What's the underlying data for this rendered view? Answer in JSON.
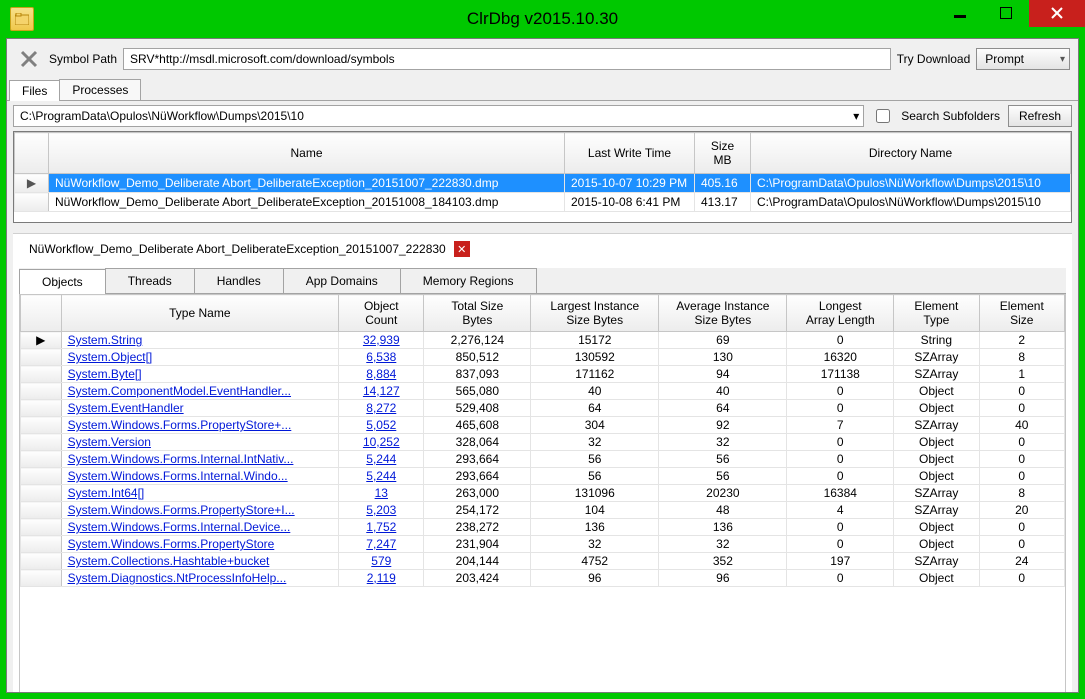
{
  "window": {
    "title": "ClrDbg v2015.10.30"
  },
  "symbol": {
    "label": "Symbol Path",
    "value": "SRV*http://msdl.microsoft.com/download/symbols",
    "try_download": "Try Download",
    "combo_value": "Prompt"
  },
  "main_tabs": [
    "Files",
    "Processes"
  ],
  "path": {
    "value": "C:\\ProgramData\\Opulos\\NüWorkflow\\Dumps\\2015\\10",
    "search_subfolders_label": "Search Subfolders",
    "refresh_label": "Refresh"
  },
  "file_grid": {
    "headers": [
      "Name",
      "Last Write Time",
      "Size MB",
      "Directory Name"
    ],
    "rows": [
      {
        "name": "NüWorkflow_Demo_Deliberate Abort_DeliberateException_20151007_222830.dmp",
        "lwt": "2015-10-07 10:29 PM",
        "size": "405.16",
        "dir": "C:\\ProgramData\\Opulos\\NüWorkflow\\Dumps\\2015\\10",
        "selected": true
      },
      {
        "name": "NüWorkflow_Demo_Deliberate Abort_DeliberateException_20151008_184103.dmp",
        "lwt": "2015-10-08 6:41 PM",
        "size": "413.17",
        "dir": "C:\\ProgramData\\Opulos\\NüWorkflow\\Dumps\\2015\\10",
        "selected": false
      }
    ]
  },
  "detail": {
    "tab_title": "NüWorkflow_Demo_Deliberate Abort_DeliberateException_20151007_222830",
    "sub_tabs": [
      "Objects",
      "Threads",
      "Handles",
      "App Domains",
      "Memory Regions"
    ]
  },
  "obj_grid": {
    "headers": [
      "Type Name",
      "Object Count",
      "Total Size Bytes",
      "Largest Instance Size Bytes",
      "Average Instance Size Bytes",
      "Longest Array Length",
      "Element Type",
      "Element Size"
    ],
    "rows": [
      {
        "type": "System.String",
        "count": "32,939",
        "total": "2,276,124",
        "largest": "15172",
        "avg": "69",
        "longest": "0",
        "etype": "String",
        "esize": "2",
        "current": true
      },
      {
        "type": "System.Object[]",
        "count": "6,538",
        "total": "850,512",
        "largest": "130592",
        "avg": "130",
        "longest": "16320",
        "etype": "SZArray",
        "esize": "8"
      },
      {
        "type": "System.Byte[]",
        "count": "8,884",
        "total": "837,093",
        "largest": "171162",
        "avg": "94",
        "longest": "171138",
        "etype": "SZArray",
        "esize": "1"
      },
      {
        "type": "System.ComponentModel.EventHandler...",
        "count": "14,127",
        "total": "565,080",
        "largest": "40",
        "avg": "40",
        "longest": "0",
        "etype": "Object",
        "esize": "0"
      },
      {
        "type": "System.EventHandler",
        "count": "8,272",
        "total": "529,408",
        "largest": "64",
        "avg": "64",
        "longest": "0",
        "etype": "Object",
        "esize": "0"
      },
      {
        "type": "System.Windows.Forms.PropertyStore+...",
        "count": "5,052",
        "total": "465,608",
        "largest": "304",
        "avg": "92",
        "longest": "7",
        "etype": "SZArray",
        "esize": "40"
      },
      {
        "type": "System.Version",
        "count": "10,252",
        "total": "328,064",
        "largest": "32",
        "avg": "32",
        "longest": "0",
        "etype": "Object",
        "esize": "0"
      },
      {
        "type": "System.Windows.Forms.Internal.IntNativ...",
        "count": "5,244",
        "total": "293,664",
        "largest": "56",
        "avg": "56",
        "longest": "0",
        "etype": "Object",
        "esize": "0"
      },
      {
        "type": "System.Windows.Forms.Internal.Windo...",
        "count": "5,244",
        "total": "293,664",
        "largest": "56",
        "avg": "56",
        "longest": "0",
        "etype": "Object",
        "esize": "0"
      },
      {
        "type": "System.Int64[]",
        "count": "13",
        "total": "263,000",
        "largest": "131096",
        "avg": "20230",
        "longest": "16384",
        "etype": "SZArray",
        "esize": "8"
      },
      {
        "type": "System.Windows.Forms.PropertyStore+I...",
        "count": "5,203",
        "total": "254,172",
        "largest": "104",
        "avg": "48",
        "longest": "4",
        "etype": "SZArray",
        "esize": "20"
      },
      {
        "type": "System.Windows.Forms.Internal.Device...",
        "count": "1,752",
        "total": "238,272",
        "largest": "136",
        "avg": "136",
        "longest": "0",
        "etype": "Object",
        "esize": "0"
      },
      {
        "type": "System.Windows.Forms.PropertyStore",
        "count": "7,247",
        "total": "231,904",
        "largest": "32",
        "avg": "32",
        "longest": "0",
        "etype": "Object",
        "esize": "0"
      },
      {
        "type": "System.Collections.Hashtable+bucket",
        "count": "579",
        "total": "204,144",
        "largest": "4752",
        "avg": "352",
        "longest": "197",
        "etype": "SZArray",
        "esize": "24"
      },
      {
        "type": "System.Diagnostics.NtProcessInfoHelp...",
        "count": "2,119",
        "total": "203,424",
        "largest": "96",
        "avg": "96",
        "longest": "0",
        "etype": "Object",
        "esize": "0"
      }
    ]
  }
}
